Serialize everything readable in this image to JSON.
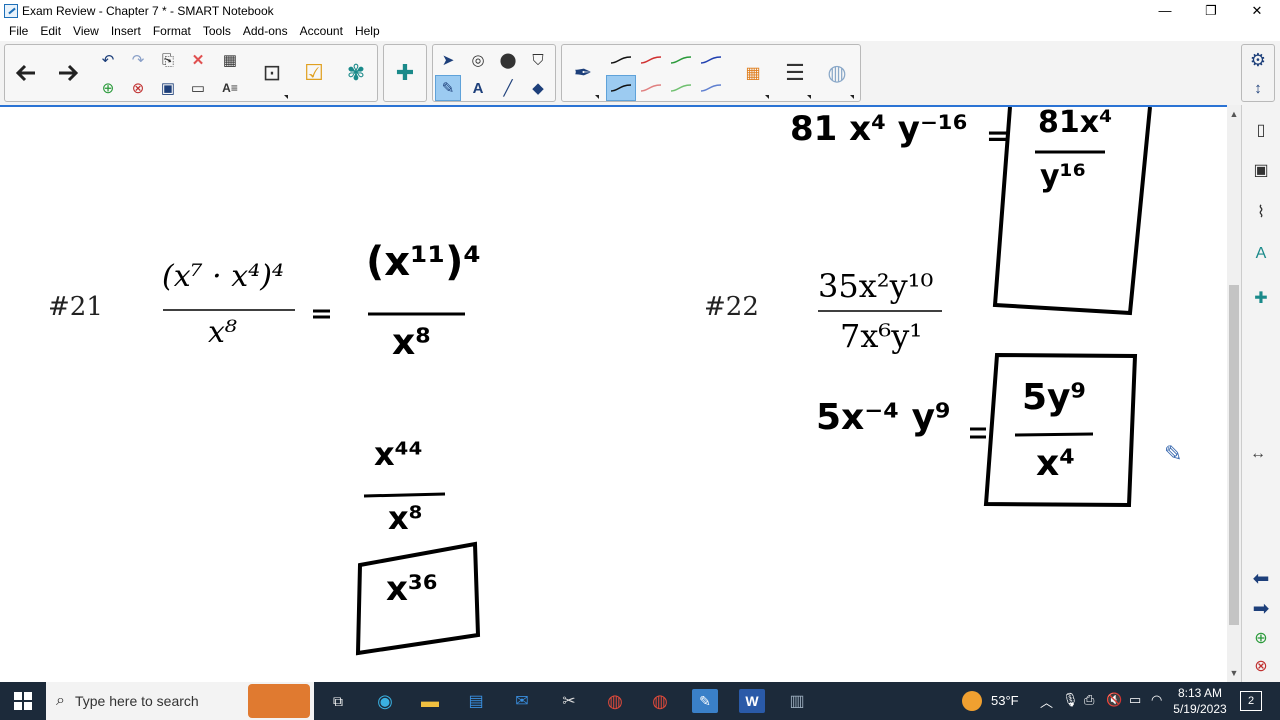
{
  "window": {
    "title": "Exam Review - Chapter 7 * - SMART Notebook",
    "minimize": "—",
    "maximize": "❐",
    "close": "✕"
  },
  "menu": [
    "File",
    "Edit",
    "View",
    "Insert",
    "Format",
    "Tools",
    "Add-ons",
    "Account",
    "Help"
  ],
  "canvas": {
    "prev_work": {
      "lhs": "81 x⁴ y⁻¹⁶",
      "eq": "=",
      "num": "81x⁴",
      "den": "y¹⁶"
    },
    "problem21": {
      "label": "#21",
      "numerator": "(x⁷ · x⁴)⁴",
      "denominator": "x⁸",
      "step1_eq": "=",
      "step1_num": "(x¹¹)⁴",
      "step1_den": "x⁸",
      "step2_num": "x⁴⁴",
      "step2_den": "x⁸",
      "answer": "x³⁶"
    },
    "problem22": {
      "label": "#22",
      "numerator": "35x²y¹⁰",
      "denominator": "7x⁶y¹",
      "step1": "5x⁻⁴ y⁹",
      "eq": "=",
      "answer_num": "5y⁹",
      "answer_den": "x⁴"
    }
  },
  "taskbar": {
    "search_placeholder": "Type here to search",
    "weather": "53°F",
    "time": "8:13 AM",
    "date": "5/19/2023",
    "notifications": "2"
  },
  "colors": {
    "accent": "#2b73d4",
    "taskbar": "#1c2a3a",
    "selected_tool": "#9ccbf1"
  }
}
